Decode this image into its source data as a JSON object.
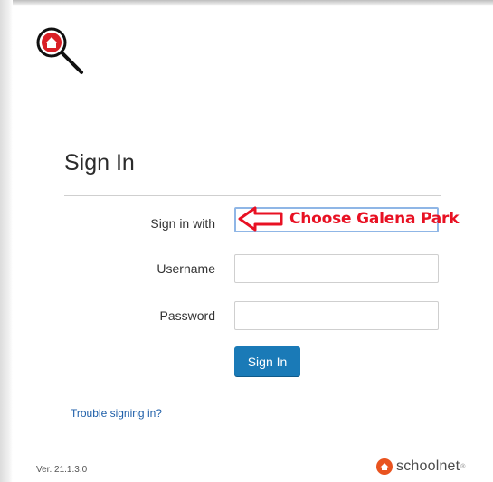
{
  "page": {
    "title": "Sign In"
  },
  "form": {
    "sign_in_with_label": "Sign in with",
    "sign_in_with_value": "",
    "username_label": "Username",
    "username_value": "",
    "password_label": "Password",
    "password_value": "",
    "submit_label": "Sign In"
  },
  "annotation": {
    "text": "Choose Galena Park",
    "color": "#e81123"
  },
  "links": {
    "trouble": "Trouble signing in?"
  },
  "footer": {
    "version": "Ver. 21.1.3.0",
    "brand": "schoolnet",
    "brand_tm": "®"
  },
  "colors": {
    "primary_button": "#1a7ab7",
    "link": "#1d5ea8",
    "brand_orange": "#e9531f",
    "logo_red": "#d91f26"
  },
  "icons": {
    "logo": "house-magnifier-icon",
    "annotation_arrow": "left-arrow-icon",
    "brand_mark": "schoolnet-logo-icon"
  }
}
